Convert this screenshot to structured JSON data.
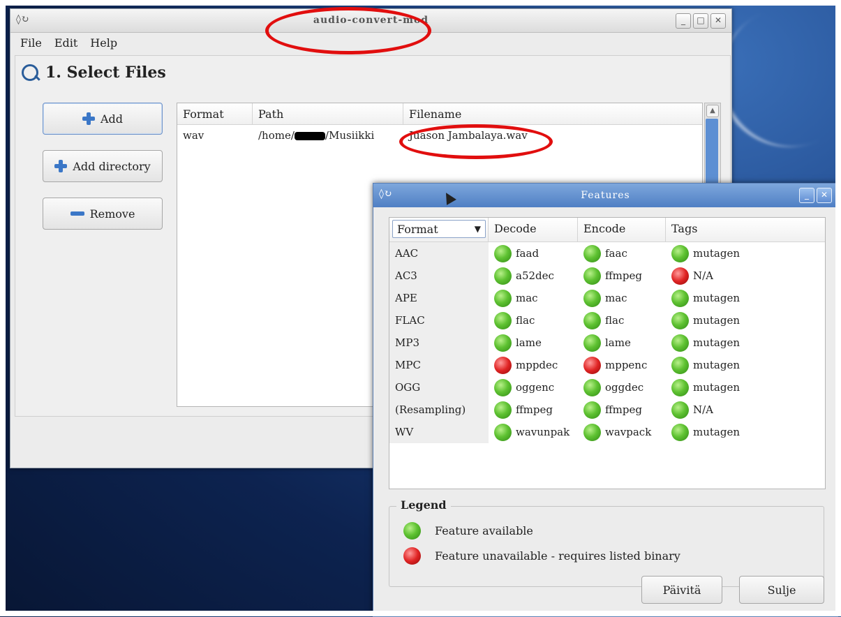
{
  "main_window": {
    "title": "audio-convert-mod",
    "menu": [
      "File",
      "Edit",
      "Help"
    ],
    "section_title": "1. Select Files",
    "buttons": {
      "add": "Add",
      "add_directory": "Add directory",
      "remove": "Remove"
    },
    "file_list": {
      "columns": [
        "Format",
        "Path",
        "Filename"
      ],
      "rows": [
        {
          "format": "wav",
          "path_prefix": "/home/",
          "path_suffix": "/Musiikki",
          "filename": "Juason Jambalaya.wav"
        }
      ]
    }
  },
  "features_window": {
    "title": "Features",
    "columns": {
      "format": "Format",
      "decode": "Decode",
      "encode": "Encode",
      "tags": "Tags"
    },
    "rows": [
      {
        "format": "AAC",
        "decode": "faad",
        "decode_status": "available",
        "encode": "faac",
        "encode_status": "available",
        "tags": "mutagen",
        "tags_status": "available"
      },
      {
        "format": "AC3",
        "decode": "a52dec",
        "decode_status": "available",
        "encode": "ffmpeg",
        "encode_status": "available",
        "tags": "N/A",
        "tags_status": "unavailable"
      },
      {
        "format": "APE",
        "decode": "mac",
        "decode_status": "available",
        "encode": "mac",
        "encode_status": "available",
        "tags": "mutagen",
        "tags_status": "available"
      },
      {
        "format": "FLAC",
        "decode": "flac",
        "decode_status": "available",
        "encode": "flac",
        "encode_status": "available",
        "tags": "mutagen",
        "tags_status": "available"
      },
      {
        "format": "MP3",
        "decode": "lame",
        "decode_status": "available",
        "encode": "lame",
        "encode_status": "available",
        "tags": "mutagen",
        "tags_status": "available"
      },
      {
        "format": "MPC",
        "decode": "mppdec",
        "decode_status": "unavailable",
        "encode": "mppenc",
        "encode_status": "unavailable",
        "tags": "mutagen",
        "tags_status": "available"
      },
      {
        "format": "OGG",
        "decode": "oggenc",
        "decode_status": "available",
        "encode": "oggdec",
        "encode_status": "available",
        "tags": "mutagen",
        "tags_status": "available"
      },
      {
        "format": "(Resampling)",
        "decode": "ffmpeg",
        "decode_status": "available",
        "encode": "ffmpeg",
        "encode_status": "available",
        "tags": "N/A",
        "tags_status": "available"
      },
      {
        "format": "WV",
        "decode": "wavunpak",
        "decode_status": "available",
        "encode": "wavpack",
        "encode_status": "available",
        "tags": "mutagen",
        "tags_status": "available"
      }
    ],
    "legend": {
      "title": "Legend",
      "available": "Feature available",
      "unavailable": "Feature unavailable - requires listed binary"
    },
    "buttons": {
      "refresh": "Päivitä",
      "close": "Sulje"
    }
  },
  "colors": {
    "available": "#5fc232",
    "unavailable": "#e02424",
    "annotation": "#e10e0e",
    "titlebar_active": "#4f7fc4"
  }
}
